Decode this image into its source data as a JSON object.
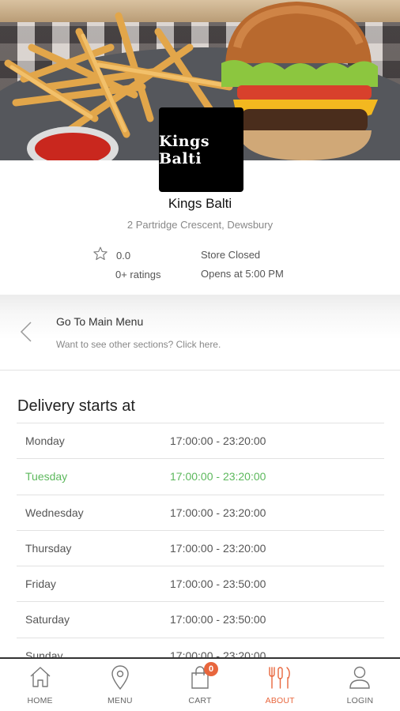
{
  "store": {
    "logo_text": "Kings Balti",
    "name": "Kings Balti",
    "address": "2 Partridge Crescent, Dewsbury",
    "rating_value": "0.0",
    "rating_count": "0+ ratings",
    "status": "Store Closed",
    "opens_at": "Opens at 5:00 PM"
  },
  "main_menu_link": {
    "title": "Go To Main Menu",
    "subtitle": "Want to see other sections? Click here."
  },
  "hours": {
    "heading": "Delivery starts at",
    "highlight_color": "#5cb85c",
    "rows": [
      {
        "day": "Monday",
        "time": "17:00:00 - 23:20:00"
      },
      {
        "day": "Tuesday",
        "time": "17:00:00 - 23:20:00",
        "today": true
      },
      {
        "day": "Wednesday",
        "time": "17:00:00 - 23:20:00"
      },
      {
        "day": "Thursday",
        "time": "17:00:00 - 23:20:00"
      },
      {
        "day": "Friday",
        "time": "17:00:00 - 23:50:00"
      },
      {
        "day": "Saturday",
        "time": "17:00:00 - 23:50:00"
      },
      {
        "day": "Sunday",
        "time": "17:00:00 - 23:20:00"
      }
    ]
  },
  "bottom_nav": {
    "accent_color": "#e8663d",
    "cart_count": "0",
    "items": [
      {
        "label": "HOME",
        "icon": "home-icon"
      },
      {
        "label": "MENU",
        "icon": "map-pin-icon"
      },
      {
        "label": "CART",
        "icon": "shopping-bag-icon"
      },
      {
        "label": "ABOUT",
        "icon": "cutlery-icon",
        "active": true
      },
      {
        "label": "LOGIN",
        "icon": "user-icon"
      }
    ]
  }
}
